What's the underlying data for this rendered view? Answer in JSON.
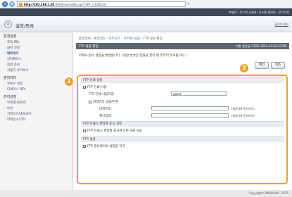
{
  "browser": {
    "url_host": "http://192.168.1.81",
    "url_path": ":8000/rps/nwftp.cgi?CSRT=1838228"
  },
  "topbar": {
    "portal": "포털로",
    "user_label": "로그인 사용자:",
    "user": "시스템 관리자",
    "logout": "로그아웃"
  },
  "header": {
    "title": "설정/등록",
    "admin_mode": "관리자 정보"
  },
  "sidebar": {
    "sections": [
      {
        "title": "환경설정",
        "items": [
          "조작 메뉴",
          "급지 설정",
          "네트워크",
          "인터페이스",
          "음량 조정",
          "사용자 유지보수"
        ]
      },
      {
        "title": "출력제어",
        "items": [
          "유튜브 설정",
          "디바이스 제어"
        ]
      },
      {
        "title": "관리설정",
        "items": [
          "부문별 ID관리",
          "보안",
          "가져오기/내보내기",
          "라이선스/기타"
        ]
      }
    ],
    "active_item": "네트워크"
  },
  "main": {
    "breadcrumb": {
      "prefix": "설정/등록 : 환경설정 : 네트워크 : TCP/IP 설정 : ",
      "current": "FTP 설정 편집"
    },
    "panel_title": "FTP 설정 편집",
    "last_updated": "최종 갱신일: 07/02 2015 04:50:19 PM",
    "info": "아래와 같이 설정을 변경합니다. (설정 변경은 전원을 껐다 켠 후부터 유효합니다.)",
    "ok_label": "확인",
    "cancel_label": "취소",
    "callouts": [
      "1",
      "2"
    ]
  },
  "form": {
    "section_print": "FTP 인쇄 설정",
    "use_ftp_print": "FTP 인쇄 사용",
    "ftp_user_label": "FTP 인쇄 사용자명:",
    "ftp_user_value": "guest",
    "set_password": "비밀번호 설정/변경",
    "password_label": "비밀번호:",
    "password_hint": "(최대 24 문자까지)",
    "confirm_label": "확인입력:",
    "confirm_hint": "(최대 24 문자까지)",
    "section_extension": "FTP 인쇄시 파일명 표시 설정",
    "utf8_label": "FTP 인쇄시 파일명 표시에 UTF-8을 사용",
    "section_pasv": "FTP 설정",
    "pasv_label": "FTP 경유에서의 설정을 허가"
  },
  "footer": {
    "copyright": "Copyright CANON INC. 2015"
  }
}
